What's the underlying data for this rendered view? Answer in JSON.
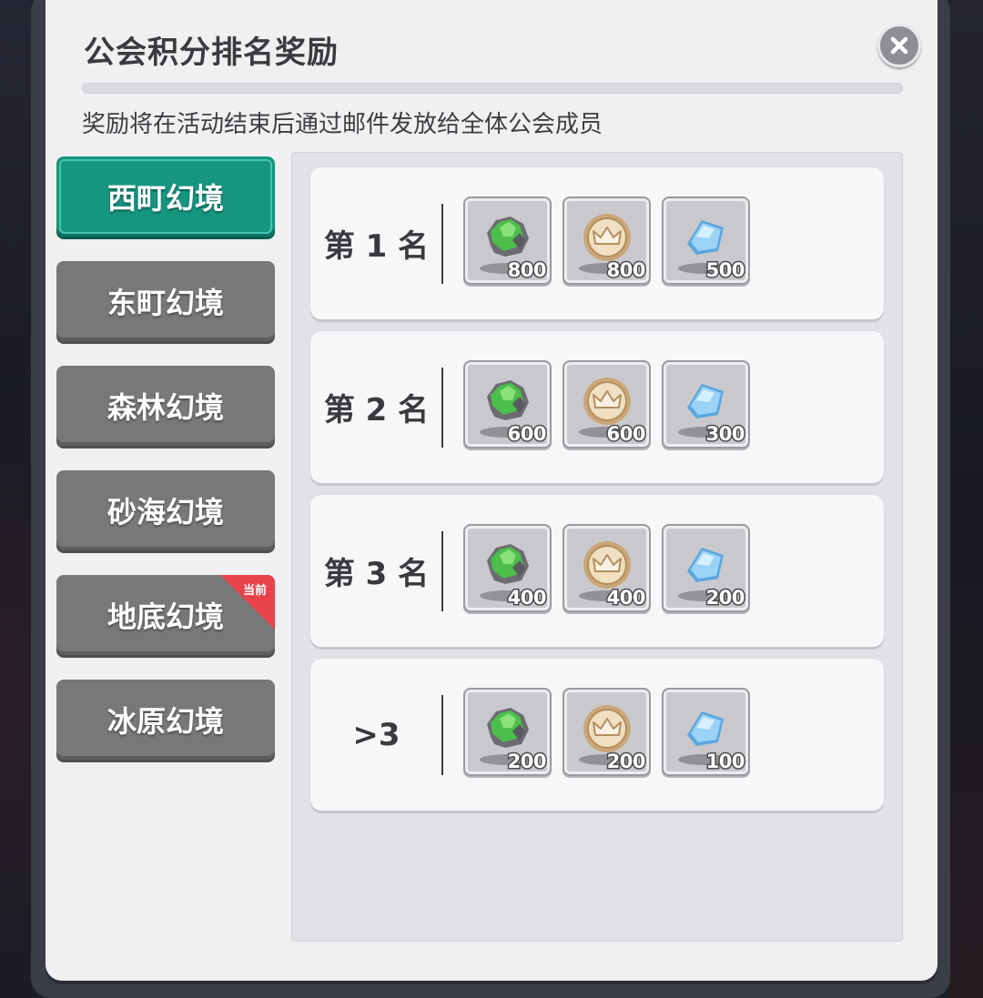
{
  "dialog": {
    "title": "公会积分排名奖励",
    "subtitle": "奖励将在活动结束后通过邮件发放给全体公会成员"
  },
  "tabs": [
    {
      "label": "西町幻境",
      "active": true
    },
    {
      "label": "东町幻境",
      "active": false
    },
    {
      "label": "森林幻境",
      "active": false
    },
    {
      "label": "砂海幻境",
      "active": false
    },
    {
      "label": "地底幻境",
      "active": false,
      "badge": "当前"
    },
    {
      "label": "冰原幻境",
      "active": false
    }
  ],
  "ranks": [
    {
      "label": "第 1 名",
      "rewards": [
        {
          "icon": "green-ore-icon",
          "count": "800"
        },
        {
          "icon": "crown-coin-icon",
          "count": "800"
        },
        {
          "icon": "blue-crystal-icon",
          "count": "500"
        }
      ]
    },
    {
      "label": "第 2 名",
      "rewards": [
        {
          "icon": "green-ore-icon",
          "count": "600"
        },
        {
          "icon": "crown-coin-icon",
          "count": "600"
        },
        {
          "icon": "blue-crystal-icon",
          "count": "300"
        }
      ]
    },
    {
      "label": "第 3 名",
      "rewards": [
        {
          "icon": "green-ore-icon",
          "count": "400"
        },
        {
          "icon": "crown-coin-icon",
          "count": "400"
        },
        {
          "icon": "blue-crystal-icon",
          "count": "200"
        }
      ]
    },
    {
      "label": ">3",
      "rewards": [
        {
          "icon": "green-ore-icon",
          "count": "200"
        },
        {
          "icon": "crown-coin-icon",
          "count": "200"
        },
        {
          "icon": "blue-crystal-icon",
          "count": "100"
        }
      ]
    }
  ],
  "colors": {
    "active_tab": "#16957f",
    "inactive_tab": "#787878",
    "badge": "#e8424a"
  }
}
